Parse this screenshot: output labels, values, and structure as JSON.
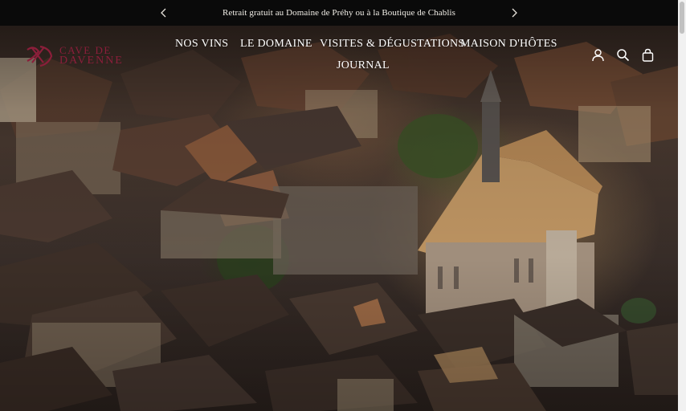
{
  "announcement": {
    "text": "Retrait gratuit au Domaine de Préhy ou à la Boutique de Chablis",
    "prev_icon": "chevron-left-icon",
    "next_icon": "chevron-right-icon"
  },
  "brand": {
    "logo_line1": "CAVE DE",
    "logo_line2": "DAVENNE",
    "logo_color": "#8b1e3a"
  },
  "nav": {
    "items": [
      {
        "label": "NOS VINS"
      },
      {
        "label": "LE DOMAINE"
      },
      {
        "label": "VISITES & DÉGUSTATIONS"
      },
      {
        "label": "MAISON D'HÔTES"
      },
      {
        "label": "JOURNAL"
      }
    ]
  },
  "header_icons": [
    "account-icon",
    "search-icon",
    "cart-icon"
  ]
}
